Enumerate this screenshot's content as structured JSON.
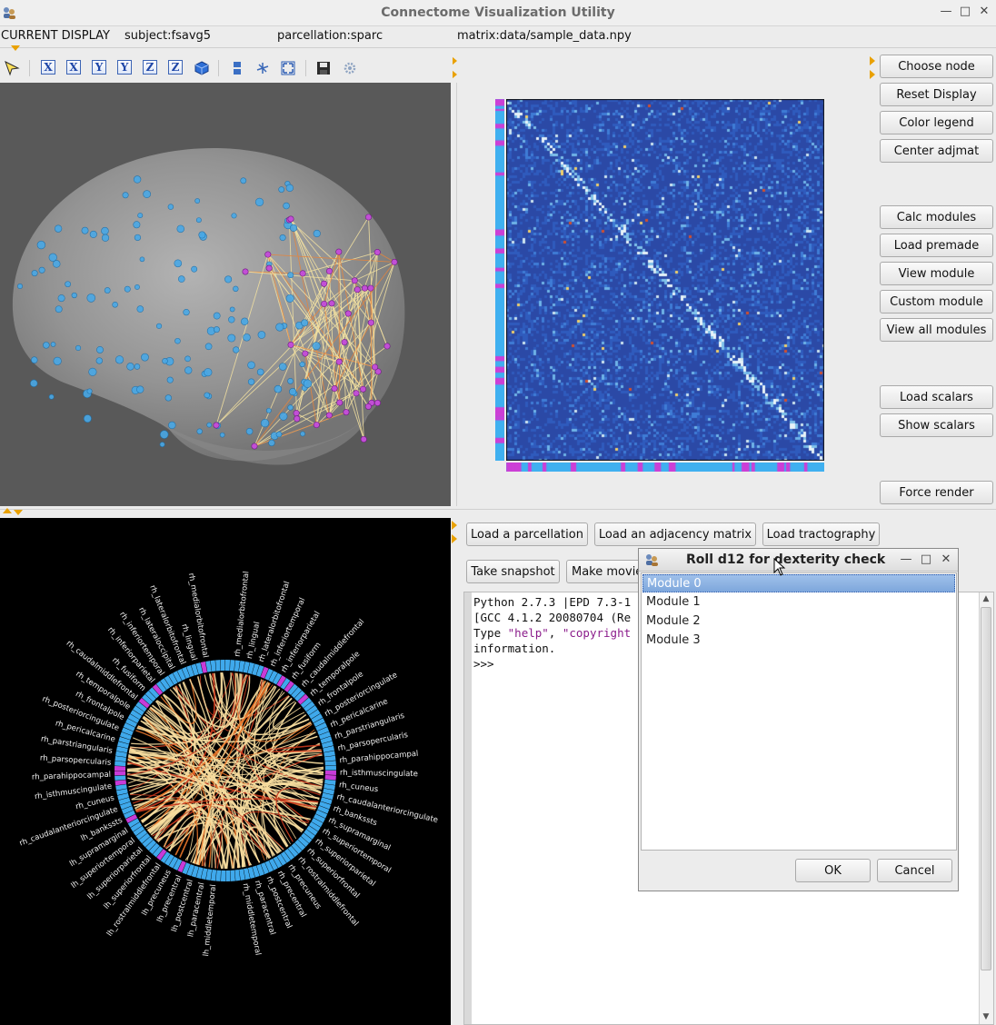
{
  "window": {
    "title": "Connectome Visualization Utility"
  },
  "status": {
    "current_display": "CURRENT DISPLAY",
    "subject": "subject:fsavg5",
    "parcellation": "parcellation:sparc",
    "matrix": "matrix:data/sample_data.npy"
  },
  "toolbar": {
    "axis_buttons": [
      "X",
      "X",
      "Y",
      "Y",
      "Z",
      "Z"
    ]
  },
  "side_buttons": {
    "choose_node": "Choose node",
    "reset_display": "Reset Display",
    "color_legend": "Color legend",
    "center_adjmat": "Center adjmat",
    "calc_modules": "Calc modules",
    "load_premade": "Load premade",
    "view_module": "View module",
    "custom_module": "Custom module",
    "view_all_modules": "View all modules",
    "load_scalars": "Load scalars",
    "show_scalars": "Show scalars",
    "force_render": "Force render"
  },
  "main_buttons": {
    "load_parcellation": "Load a parcellation",
    "load_adjmat": "Load an adjacency matrix",
    "load_tractography": "Load tractography",
    "take_snapshot": "Take snapshot",
    "make_movie": "Make movie"
  },
  "console": {
    "line1": "Python 2.7.3 |EPD 7.3-1",
    "line2": "[GCC 4.1.2 20080704 (Re",
    "line3_pre": "Type ",
    "line3_help": "\"help\"",
    "line3_mid": ", ",
    "line3_copy": "\"copyright",
    "line4": "information.",
    "prompt": ">>>"
  },
  "dialog": {
    "title": "Roll d12 for dexterity check",
    "items": [
      "Module 0",
      "Module 1",
      "Module 2",
      "Module 3"
    ],
    "selected_index": 0,
    "ok": "OK",
    "cancel": "Cancel"
  },
  "circle_labels": {
    "right": [
      "rh_medialorbitofrontal",
      "rh_lingual",
      "rh_lateralorbitofrontal",
      "rh_inferiortemporal",
      "rh_inferiorparietal",
      "rh_fusiform",
      "rh_caudalmiddlefrontal",
      "rh_temporalpole",
      "rh_frontalpole",
      "rh_posteriorcingulate",
      "rh_pericalcarine",
      "rh_parstriangularis",
      "rh_parsopercularis",
      "rh_parahippocampal",
      "rh_isthmuscingulate",
      "rh_cuneus",
      "rh_caudalanteriorcingulate",
      "rh_bankssts",
      "rh_supramarginal",
      "rh_superiortemporal",
      "rh_superiorparietal",
      "rh_superiorfrontal",
      "rh_rostralmiddlefrontal",
      "rh_precuneus",
      "rh_precentral",
      "rh_postcentral",
      "rh_paracentral",
      "rh_middletemporal"
    ],
    "left": [
      "lh_middletemporal",
      "lh_paracentral",
      "lh_postcentral",
      "lh_precentral",
      "lh_precuneus",
      "lh_rostralmiddlefrontal",
      "lh_superiorfrontal",
      "lh_superiorparietal",
      "lh_superiortemporal",
      "lh_supramarginal",
      "lh_bankssts",
      "rh_caudalanteriorcingulate",
      "rh_cuneus",
      "rh_isthmuscingulate",
      "rh_parahippocampal",
      "rh_parsopercularis",
      "rh_parstriangularis",
      "rh_pericalcarine",
      "rh_posteriorcingulate",
      "rh_frontalpole",
      "rh_temporalpole",
      "rh_caudalmiddlefrontal",
      "rh_fusiform",
      "rh_inferiorparietal",
      "rh_inferiortemporal",
      "rh_lateraloccipital",
      "rh_lateralorbitofrontal",
      "rh_lingual",
      "rh_medialorbitofrontal"
    ]
  }
}
